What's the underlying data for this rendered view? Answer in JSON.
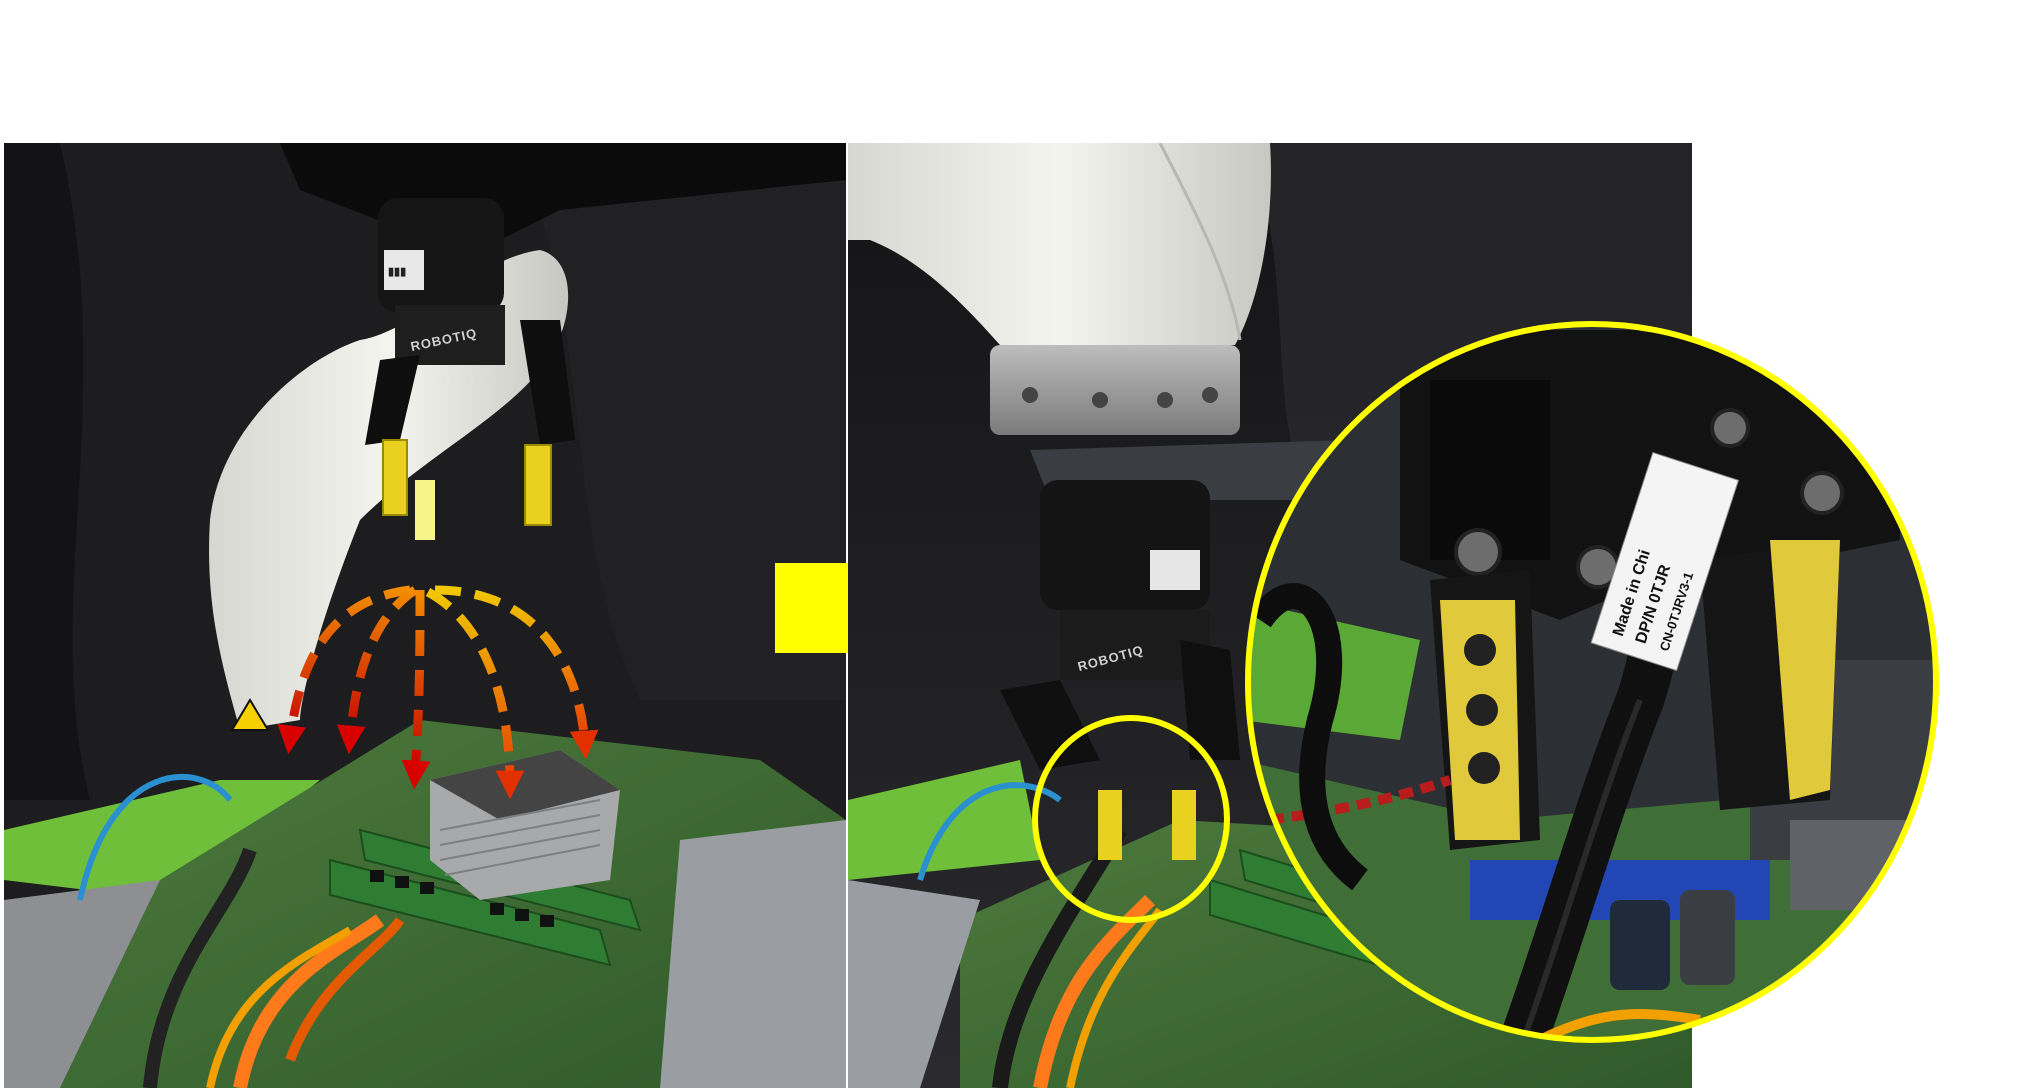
{
  "panels": {
    "left": {
      "description_name": "robot-gripper-before-insertion"
    },
    "right": {
      "description_name": "robot-gripper-after-insertion"
    }
  },
  "printed_text": {
    "gripper_brand": "ROBOTIQ",
    "cable_label_line1": "Made in Chi",
    "cable_label_line2": "DP/N 0TJR",
    "cable_label_line3": "CN-0TJRV3-1"
  },
  "colors": {
    "transition_arrow": "#ffff00",
    "zoom_circle": "#ffff00",
    "trajectory_arrow_gradient": [
      "#f0c000",
      "#ff8c00",
      "#e60000",
      "#a50000"
    ],
    "background": "#ffffff"
  },
  "icons": {
    "transition_arrow": "right-arrow-icon",
    "trajectories": "curved-dashed-arrow-icon"
  },
  "trajectory_count": 5
}
